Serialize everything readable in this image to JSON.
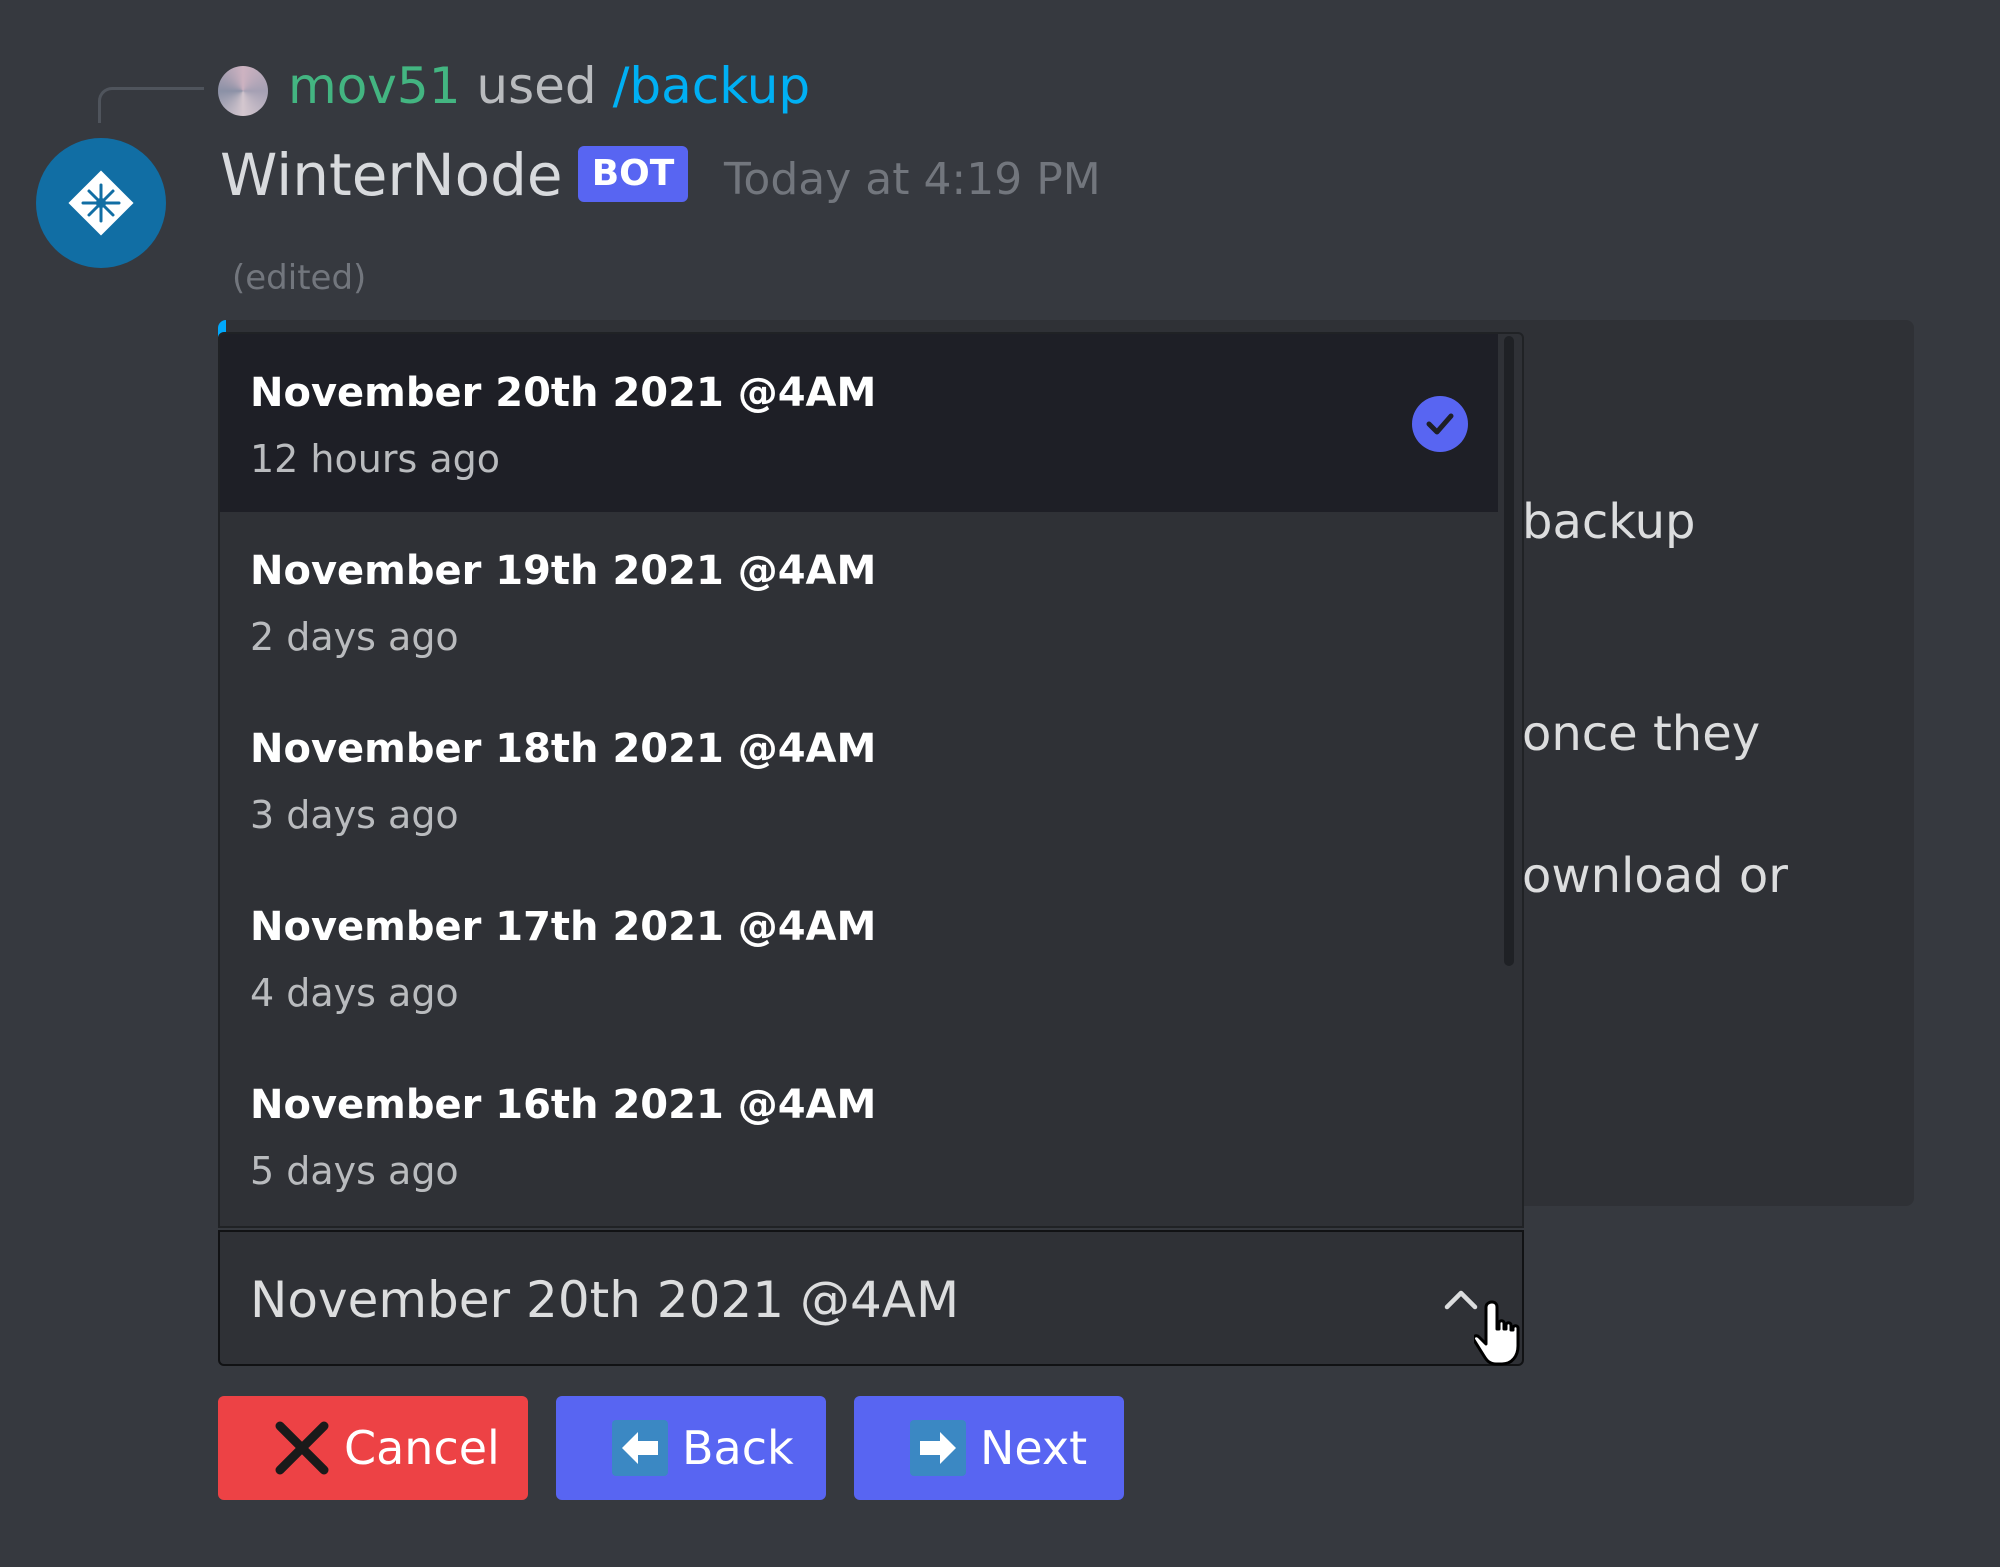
{
  "reply": {
    "username": "mov51",
    "used_text": "used",
    "command": "/backup"
  },
  "message": {
    "author": "WinterNode",
    "badge": "BOT",
    "timestamp": "Today at 4:19 PM",
    "edited": "(edited)"
  },
  "embed": {
    "partial_lines": [
      "backup",
      "once they",
      "ownload or"
    ]
  },
  "dropdown": {
    "options": [
      {
        "label": "November 20th 2021 @4AM",
        "description": "12 hours ago",
        "selected": true
      },
      {
        "label": "November 19th 2021 @4AM",
        "description": "2 days ago",
        "selected": false
      },
      {
        "label": "November 18th 2021 @4AM",
        "description": "3 days ago",
        "selected": false
      },
      {
        "label": "November 17th 2021 @4AM",
        "description": "4 days ago",
        "selected": false
      },
      {
        "label": "November 16th 2021 @4AM",
        "description": "5 days ago",
        "selected": false
      }
    ],
    "selected_value": "November 20th 2021 @4AM"
  },
  "buttons": {
    "cancel": "Cancel",
    "back": "Back",
    "next": "Next"
  },
  "colors": {
    "background": "#36393f",
    "username": "#43b581",
    "command": "#00b0f4",
    "blurple": "#5865f2",
    "danger": "#ed4245"
  },
  "icons": {
    "bot_avatar": "snowflake-icon",
    "selected": "check-circle-icon",
    "chevron": "chevron-up-icon",
    "cancel": "x-icon",
    "back": "arrow-left-icon",
    "next": "arrow-right-icon"
  }
}
